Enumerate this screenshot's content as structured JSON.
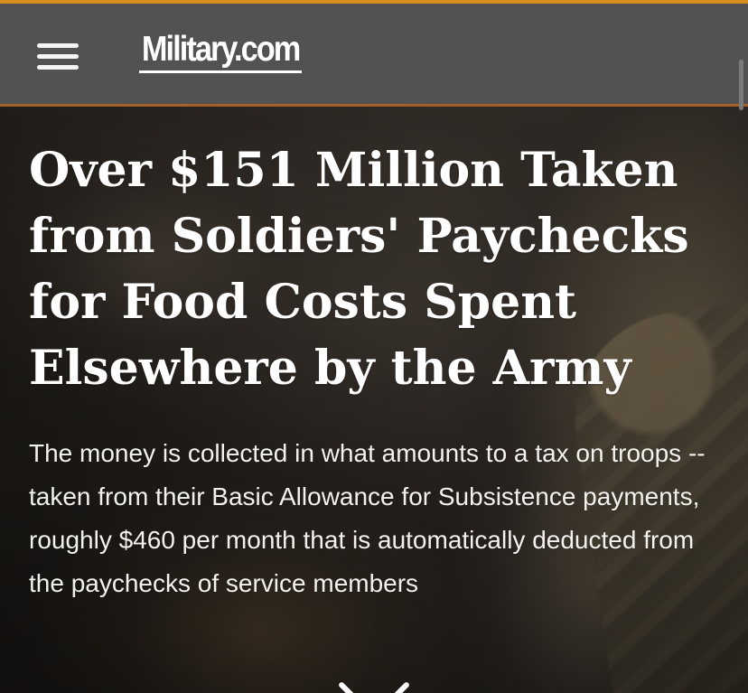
{
  "header": {
    "menu_icon": "hamburger-menu-icon",
    "logo_text": "Military.com"
  },
  "article": {
    "headline": "Over $151 Million Taken from Soldiers' Paychecks for Food Costs Spent Elsewhere by the Army",
    "dek": "The money is collected in what amounts to a tax on troops -- taken from their Basic Allowance for Subsistence payments, roughly $460 per month that is automatically deducted from the paychecks of service members"
  },
  "controls": {
    "scroll_down_icon": "chevron-down-icon"
  },
  "colors": {
    "header_background": "#525252",
    "header_accent": "#d88c1d",
    "text": "#ffffff"
  }
}
